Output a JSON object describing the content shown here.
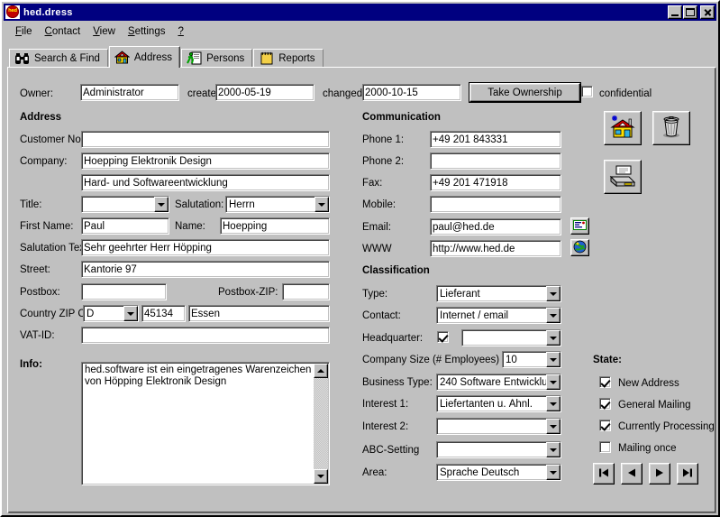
{
  "window": {
    "title": "hed.dress",
    "icon": "app-logo-icon",
    "buttons": {
      "minimize": "minimize-icon",
      "maximize": "maximize-icon",
      "close": "close-icon"
    }
  },
  "menu": {
    "items": [
      {
        "label": "File",
        "accel": "F"
      },
      {
        "label": "Contact",
        "accel": "C"
      },
      {
        "label": "View",
        "accel": "V"
      },
      {
        "label": "Settings",
        "accel": "S"
      },
      {
        "label": "?",
        "accel": "?"
      }
    ]
  },
  "tabs": [
    {
      "label": "Search & Find",
      "icon": "binoculars-icon",
      "active": false
    },
    {
      "label": "Address",
      "icon": "house-icon",
      "active": true
    },
    {
      "label": "Persons",
      "icon": "running-person-icon",
      "active": false
    },
    {
      "label": "Reports",
      "icon": "notepad-icon",
      "active": false
    }
  ],
  "header": {
    "owner_label": "Owner:",
    "owner_value": "Administrator",
    "created_label": "created:",
    "created_value": "2000-05-19",
    "changed_label": "changed:",
    "changed_value": "2000-10-15",
    "take_ownership": "Take Ownership",
    "confidential_label": "confidential",
    "confidential_checked": false
  },
  "address": {
    "section_title": "Address",
    "customer_no_label": "Customer No.:",
    "customer_no_value": "",
    "company_label": "Company:",
    "company_value": "Hoepping Elektronik Design",
    "company2_value": "Hard- und Softwareentwicklung",
    "title_label": "Title:",
    "title_value": "",
    "salutation_label": "Salutation:",
    "salutation_value": "Herrn",
    "first_name_label": "First Name:",
    "first_name_value": "Paul",
    "name_label": "Name:",
    "name_value": "Hoepping",
    "salutation_text_label": "Salutation Text",
    "salutation_text_value": "Sehr geehrter Herr Höpping",
    "street_label": "Street:",
    "street_value": "Kantorie 97",
    "postbox_label": "Postbox:",
    "postbox_value": "",
    "postbox_zip_label": "Postbox-ZIP:",
    "postbox_zip_value": "",
    "country_zip_city_label": "Country ZIP Ci",
    "country_value": "D",
    "zip_value": "45134",
    "city_value": "Essen",
    "vat_label": "VAT-ID:",
    "vat_value": ""
  },
  "info": {
    "label": "Info:",
    "text": "hed.software ist ein eingetragenes Warenzeichen von Höpping Elektronik Design"
  },
  "communication": {
    "section_title": "Communication",
    "phone1_label": "Phone 1:",
    "phone1_value": "+49 201 843331",
    "phone2_label": "Phone 2:",
    "phone2_value": "",
    "fax_label": "Fax:",
    "fax_value": "+49 201 471918",
    "mobile_label": "Mobile:",
    "mobile_value": "",
    "email_label": "Email:",
    "email_value": "paul@hed.de",
    "email_button_icon": "envelope-icon",
    "www_label": "WWW",
    "www_value": "http://www.hed.de",
    "www_button_icon": "globe-icon"
  },
  "classification": {
    "section_title": "Classification",
    "type_label": "Type:",
    "type_value": "Lieferant",
    "contact_label": "Contact:",
    "contact_value": "Internet / email",
    "headquarter_label": "Headquarter:",
    "headquarter_checked": true,
    "headquarter_value": "",
    "company_size_label": "Company Size (# Employees)",
    "company_size_value": "10",
    "business_type_label": "Business Type:",
    "business_type_value": "240   Software Entwicklu",
    "interest1_label": "Interest 1:",
    "interest1_value": "Liefertanten u. Ähnl.",
    "interest2_label": "Interest 2:",
    "interest2_value": "",
    "abc_label": "ABC-Setting",
    "abc_value": "",
    "area_label": "Area:",
    "area_value": "Sprache Deutsch"
  },
  "state": {
    "section_title": "State:",
    "items": [
      {
        "label": "New Address",
        "checked": true
      },
      {
        "label": "General Mailing",
        "checked": true
      },
      {
        "label": "Currently Processing",
        "checked": true
      },
      {
        "label": "Mailing once",
        "checked": false
      }
    ]
  },
  "toolbar": {
    "new_icon": "new-address-house-icon",
    "delete_icon": "trash-can-icon",
    "print_icon": "printer-icon"
  },
  "navigation": [
    {
      "icon": "first-record-icon"
    },
    {
      "icon": "previous-record-icon"
    },
    {
      "icon": "next-record-icon"
    },
    {
      "icon": "last-record-icon"
    }
  ],
  "colors": {
    "face": "#c0c0c0",
    "titlebar": "#000080",
    "field": "#ffffff",
    "shadow": "#808080"
  }
}
